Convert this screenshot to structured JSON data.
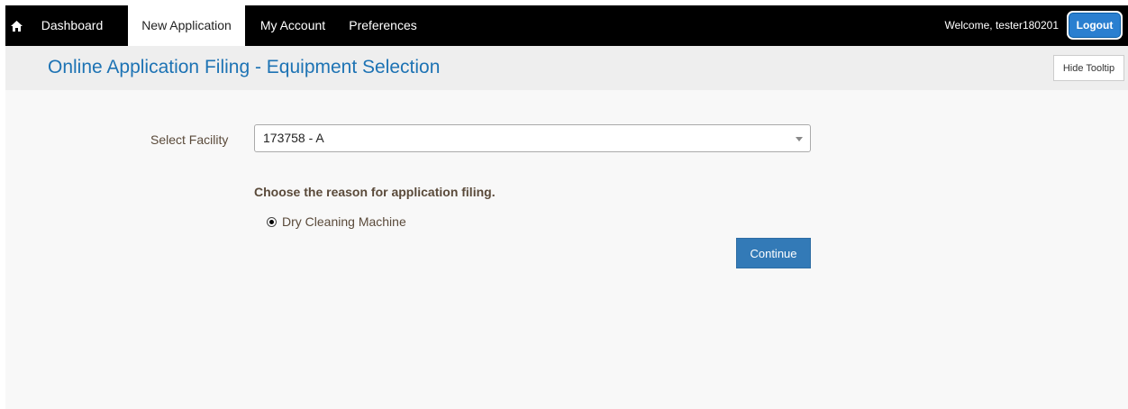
{
  "nav": {
    "home_icon": "home-icon",
    "items": [
      {
        "label": "Dashboard",
        "active": false
      },
      {
        "label": "New Application",
        "active": true
      },
      {
        "label": "My Account",
        "active": false
      },
      {
        "label": "Preferences",
        "active": false
      }
    ],
    "welcome": "Welcome, tester180201",
    "logout_label": "Logout"
  },
  "header": {
    "title": "Online Application Filing - Equipment Selection",
    "tooltip_button": "Hide Tooltip"
  },
  "form": {
    "facility_label": "Select Facility",
    "facility_selected": "173758 - A",
    "reason_heading": "Choose the reason for application filing.",
    "reason_option": {
      "label": "Dry Cleaning Machine",
      "checked": true
    },
    "continue_label": "Continue"
  },
  "colors": {
    "navbar": "#000000",
    "title": "#1d73b4",
    "primary_button": "#337ab7",
    "logout_button": "#2a7fd0"
  }
}
